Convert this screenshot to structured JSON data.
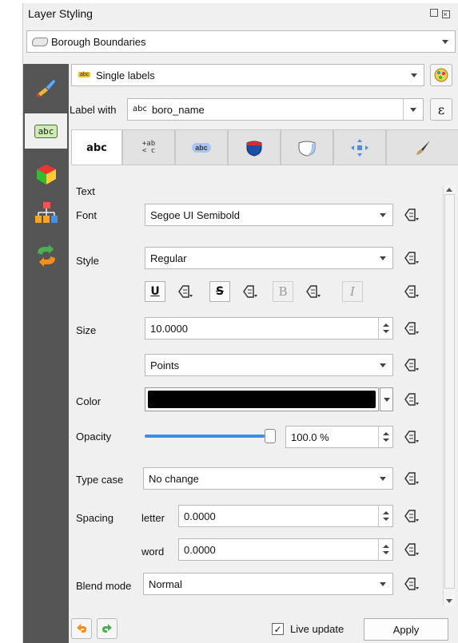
{
  "window": {
    "title": "Layer Styling",
    "float_icon": "float-icon",
    "close_icon": "close-icon"
  },
  "layer_select": {
    "value": "Borough Boundaries"
  },
  "label_mode": {
    "value": "Single labels"
  },
  "label_with": {
    "label": "Label with",
    "prefix": "abc",
    "value": "boro_name",
    "expr_button": "ε"
  },
  "tabs": [
    {
      "name": "text",
      "label": "abc",
      "active": true
    },
    {
      "name": "formatting",
      "label": "+ab\n< c"
    },
    {
      "name": "buffer",
      "label": "abc"
    },
    {
      "name": "background",
      "icon": "shield-icon"
    },
    {
      "name": "shadow",
      "icon": "shadow-icon"
    },
    {
      "name": "placement",
      "icon": "placement-icon"
    },
    {
      "name": "rendering",
      "icon": "brush-icon"
    }
  ],
  "section": {
    "heading": "Text"
  },
  "fields": {
    "font": {
      "label": "Font",
      "value": "Segoe UI Semibold"
    },
    "style": {
      "label": "Style",
      "value": "Regular"
    },
    "format_buttons": {
      "underline": "U",
      "strikeout": "S",
      "bold": "B",
      "italic": "I"
    },
    "size": {
      "label": "Size",
      "value": "10.0000"
    },
    "unit": {
      "value": "Points"
    },
    "color": {
      "label": "Color",
      "value": "#000000"
    },
    "opacity": {
      "label": "Opacity",
      "value": "100.0 %",
      "level": 1.0
    },
    "type_case": {
      "label": "Type case",
      "value": "No change"
    },
    "spacing": {
      "label": "Spacing",
      "letter_label": "letter",
      "letter_value": "0.0000",
      "word_label": "word",
      "word_value": "0.0000"
    },
    "blend": {
      "label": "Blend mode",
      "value": "Normal"
    }
  },
  "footer": {
    "live_update_label": "Live update",
    "live_update_checked": true,
    "apply_label": "Apply"
  },
  "colors": {
    "sidebar": "#555555",
    "accent": "#3a8ee6"
  }
}
